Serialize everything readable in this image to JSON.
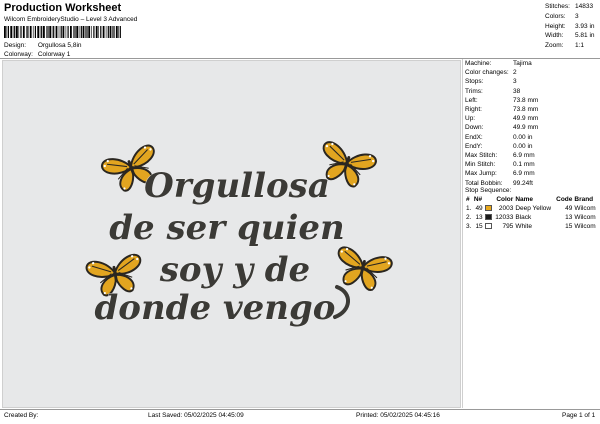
{
  "header": {
    "title": "Production Worksheet",
    "subtitle": "Wilcom EmbroideryStudio – Level 3 Advanced",
    "design_label": "Design:",
    "design_value": "Orgullosa 5,8in",
    "colorway_label": "Colorway:",
    "colorway_value": "Colorway 1"
  },
  "top_stats": [
    {
      "label": "Stitches:",
      "value": "14833"
    },
    {
      "label": "Colors:",
      "value": "3"
    },
    {
      "label": "Height:",
      "value": "3.93 in"
    },
    {
      "label": "Width:",
      "value": "5.81 in"
    },
    {
      "label": "Zoom:",
      "value": "1:1"
    }
  ],
  "machine_info": [
    {
      "label": "Machine:",
      "value": "Tajima"
    },
    {
      "label": "Color changes:",
      "value": "2"
    },
    {
      "label": "Stops:",
      "value": "3"
    },
    {
      "label": "Trims:",
      "value": "38"
    },
    {
      "label": "Left:",
      "value": "73.8 mm"
    },
    {
      "label": "Right:",
      "value": "73.8 mm"
    },
    {
      "label": "Up:",
      "value": "49.9 mm"
    },
    {
      "label": "Down:",
      "value": "49.9 mm"
    },
    {
      "label": "EndX:",
      "value": "0.00 in"
    },
    {
      "label": "EndY:",
      "value": "0.00 in"
    },
    {
      "label": "Max Stitch:",
      "value": "6.9 mm"
    },
    {
      "label": "Min Stitch:",
      "value": "0.1 mm"
    },
    {
      "label": "Max Jump:",
      "value": "6.9 mm"
    },
    {
      "label": "Total Bobbin:",
      "value": "99.24ft"
    }
  ],
  "stop_sequence": {
    "title": "Stop Sequence:",
    "headers": {
      "n": "#",
      "n2": "N#",
      "color": "Color",
      "name": "Name",
      "code": "Code",
      "brand": "Brand"
    },
    "rows": [
      {
        "stop": "1.",
        "needle": "49",
        "swatch": "#e8a81c",
        "color": "2003",
        "name": "Deep Yellow",
        "code": "49",
        "brand": "Wilcom"
      },
      {
        "stop": "2.",
        "needle": "13",
        "swatch": "#1a1a1a",
        "color": "12033",
        "name": "Black",
        "code": "13",
        "brand": "Wilcom"
      },
      {
        "stop": "3.",
        "needle": "15",
        "swatch": "#ffffff",
        "color": "795",
        "name": "White",
        "code": "15",
        "brand": "Wilcom"
      }
    ]
  },
  "design": {
    "lines": [
      "Orgullosa",
      "de ser quien",
      "soy y de",
      "donde vengo"
    ],
    "text_color": "#3b3a36",
    "wing_color": "#e2a520"
  },
  "footer": {
    "created": "Created By:",
    "saved": "Last Saved: 05/02/2025 04:45:09",
    "printed": "Printed: 05/02/2025 04:45:16",
    "page": "Page 1 of 1"
  }
}
